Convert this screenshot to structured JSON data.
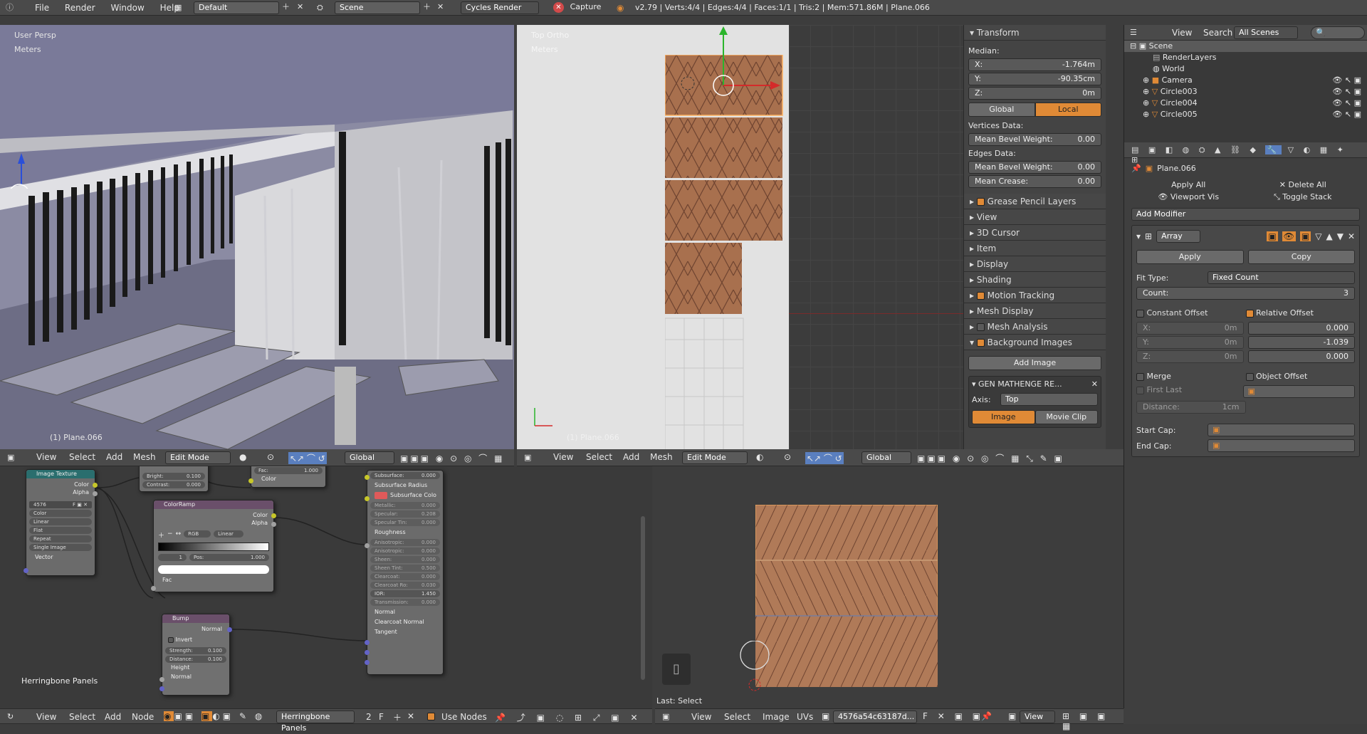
{
  "topbar": {
    "menus": [
      "File",
      "Render",
      "Window",
      "Help"
    ],
    "layout": "Default",
    "scene": "Scene",
    "engine": "Cycles Render",
    "capture": "Capture",
    "stats": "v2.79 | Verts:4/4 | Edges:4/4 | Faces:1/1 | Tris:2 | Mem:571.86M | Plane.066"
  },
  "viewport_left": {
    "persp": "User Persp",
    "units": "Meters",
    "object_label": "(1) Plane.066"
  },
  "viewport_top": {
    "view": "Top Ortho",
    "units": "Meters",
    "object_label": "(1) Plane.066"
  },
  "properties_panel": {
    "transform_title": "Transform",
    "median": "Median:",
    "x_label": "X:",
    "x_val": "-1.764m",
    "y_label": "Y:",
    "y_val": "-90.35cm",
    "z_label": "Z:",
    "z_val": "0m",
    "global": "Global",
    "local": "Local",
    "vertices_data": "Vertices Data:",
    "mean_bevel_weight": "Mean Bevel Weight:",
    "mbw_v": "0.00",
    "edges_data": "Edges Data:",
    "mbw_e": "0.00",
    "mean_crease": "Mean Crease:",
    "mc_v": "0.00",
    "sections": [
      "Grease Pencil Layers",
      "View",
      "3D Cursor",
      "Item",
      "Display",
      "Shading",
      "Motion Tracking",
      "Mesh Display",
      "Mesh Analysis",
      "Background Images"
    ],
    "add_image": "Add Image",
    "bg_image_name": "GEN MATHENGE RE...",
    "axis_label": "Axis:",
    "axis_val": "Top",
    "tab_image": "Image",
    "tab_movie": "Movie Clip"
  },
  "outliner": {
    "menus": [
      "View",
      "Search"
    ],
    "filter": "All Scenes",
    "items": [
      "Scene",
      "RenderLayers",
      "World",
      "Camera",
      "Circle003",
      "Circle004",
      "Circle005"
    ]
  },
  "modifiers": {
    "object": "Plane.066",
    "apply_all": "Apply All",
    "delete_all": "Delete All",
    "viewport_vis": "Viewport Vis",
    "toggle_stack": "Toggle Stack",
    "add_modifier": "Add Modifier",
    "name": "Array",
    "apply": "Apply",
    "copy": "Copy",
    "fit_type_label": "Fit Type:",
    "fit_type": "Fixed Count",
    "count_label": "Count:",
    "count": "3",
    "constant_offset": "Constant Offset",
    "relative_offset": "Relative Offset",
    "cx": "X:",
    "cx_v": "0m",
    "cy": "Y:",
    "cy_v": "0m",
    "cz": "Z:",
    "cz_v": "0m",
    "rx_v": "0.000",
    "ry_v": "-1.039",
    "rz_v": "0.000",
    "merge": "Merge",
    "object_offset": "Object Offset",
    "first_last": "First Last",
    "distance_label": "Distance:",
    "distance": "1cm",
    "start_cap": "Start Cap:",
    "end_cap": "End Cap:"
  },
  "header3d_left": {
    "items": [
      "View",
      "Select",
      "Add",
      "Mesh"
    ],
    "mode": "Edit Mode",
    "orient": "Global"
  },
  "header3d_right": {
    "items": [
      "View",
      "Select",
      "Add",
      "Mesh"
    ],
    "mode": "Edit Mode",
    "orient": "Global"
  },
  "node_editor": {
    "material": "Herringbone Panels",
    "users": "2",
    "menus": [
      "View",
      "Select",
      "Add",
      "Node"
    ],
    "use_nodes": "Use Nodes",
    "image_texture": {
      "title": "Image Texture",
      "color": "Color",
      "alpha": "Alpha",
      "img": "4576",
      "opts": [
        "Color",
        "Linear",
        "Flat",
        "Repeat",
        "Single Image"
      ],
      "vector": "Vector"
    },
    "brightcontrast": {
      "bright": "Bright:",
      "bright_v": "0.100",
      "contrast": "Contrast:",
      "contrast_v": "0.000"
    },
    "mix": {
      "fac": "Fac:",
      "fac_v": "1.000",
      "color": "Color"
    },
    "colorramp": {
      "title": "ColorRamp",
      "color": "Color",
      "alpha": "Alpha",
      "mode": "RGB",
      "interp": "Linear",
      "idx": "1",
      "pos": "Pos:",
      "pos_v": "1.000",
      "fac": "Fac"
    },
    "bump": {
      "title": "Bump",
      "normal": "Normal",
      "invert": "Invert",
      "strength": "Strength:",
      "strength_v": "0.100",
      "distance": "Distance:",
      "distance_v": "0.100",
      "height": "Height",
      "normal_in": "Normal"
    },
    "principled": [
      [
        "Subsurface:",
        "0.000"
      ],
      [
        "Subsurface Radius",
        ""
      ],
      [
        "Subsurface Colo",
        ""
      ],
      [
        "Metallic:",
        "0.000"
      ],
      [
        "Specular:",
        "0.208"
      ],
      [
        "Specular Tin:",
        "0.000"
      ],
      [
        "Roughness",
        ""
      ],
      [
        "Anisotropic:",
        "0.000"
      ],
      [
        "Anisotropic:",
        "0.000"
      ],
      [
        "Sheen:",
        "0.000"
      ],
      [
        "Sheen Tint:",
        "0.500"
      ],
      [
        "Clearcoat:",
        "0.000"
      ],
      [
        "Clearcoat Ro:",
        "0.030"
      ],
      [
        "IOR:",
        "1.450"
      ],
      [
        "Transmission:",
        "0.000"
      ],
      [
        "Normal",
        ""
      ],
      [
        "Clearcoat Normal",
        ""
      ],
      [
        "Tangent",
        ""
      ]
    ]
  },
  "uv_editor": {
    "menus": [
      "View",
      "Select",
      "Image",
      "UVs"
    ],
    "image": "4576a54c63187d...",
    "last_op": "Last: Select",
    "view": "View"
  },
  "colors": {
    "accent": "#e08a36",
    "wood": "#a8704e",
    "select": "#5a5f8f"
  }
}
